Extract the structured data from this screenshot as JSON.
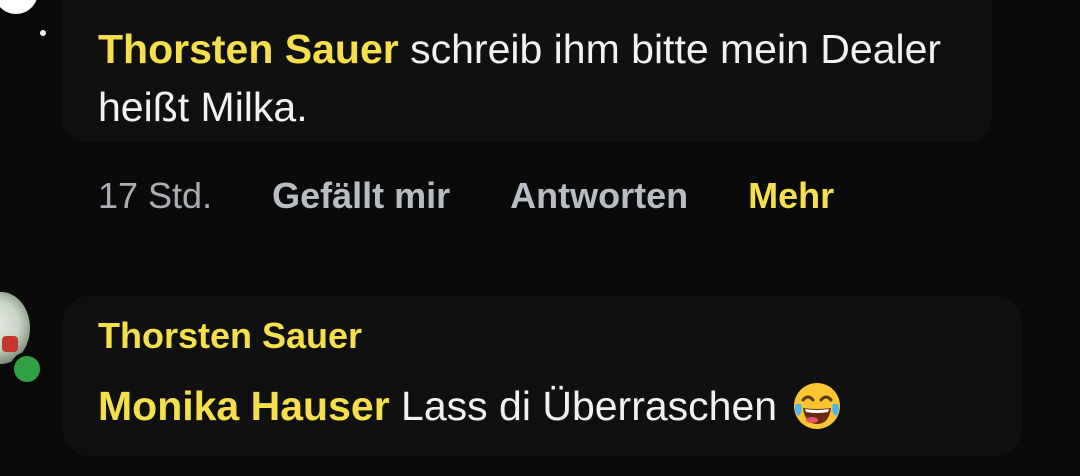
{
  "comment": {
    "mention": "Thorsten Sauer",
    "text": " schreib ihm bitte mein Dealer heißt Milka.",
    "time": "17 Std.",
    "actions": {
      "like": "Gefällt mir",
      "reply": "Antworten",
      "more": "Mehr"
    }
  },
  "reply": {
    "author": "Thorsten Sauer",
    "mention": "Monika Hauser",
    "text": " Lass di Überraschen",
    "emoji": "face-with-tears-of-joy-icon",
    "online_status_color": "#2ea043"
  },
  "colors": {
    "background": "#0a0a0a",
    "bubble": "#101010",
    "accent": "#f5e04c",
    "text": "#f2f2f2",
    "muted": "#a9aeb4"
  }
}
